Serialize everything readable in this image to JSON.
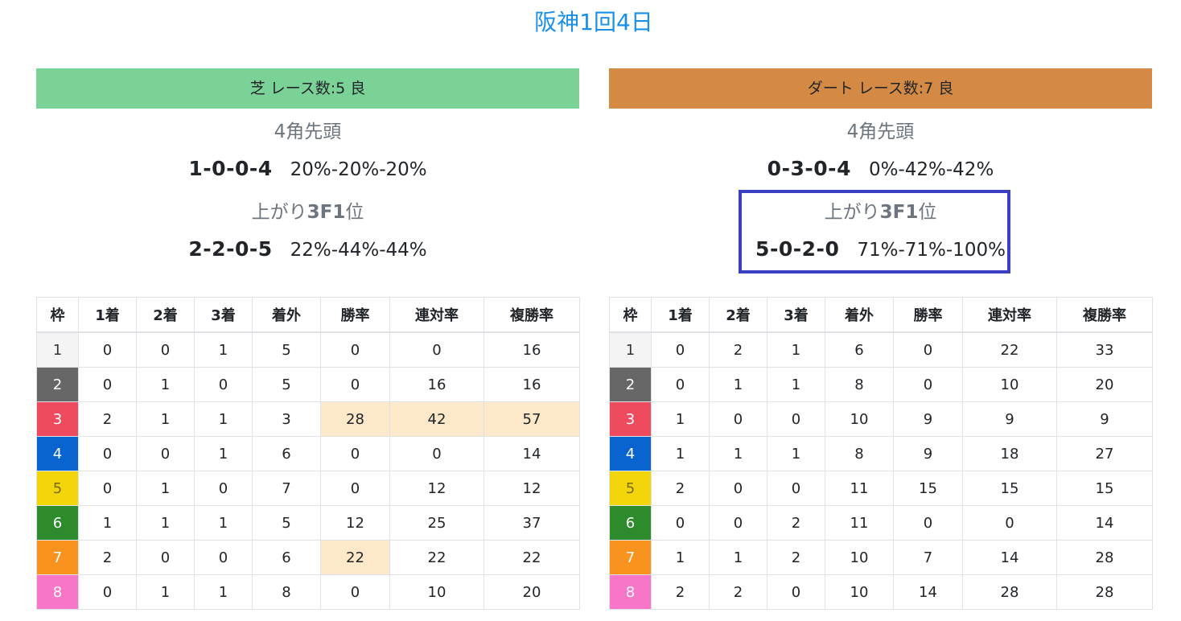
{
  "page_title": "阪神1回4日",
  "headers": [
    "枠",
    "1着",
    "2着",
    "3着",
    "着外",
    "勝率",
    "連対率",
    "複勝率"
  ],
  "panels": [
    {
      "header": "芝 レース数:5 良",
      "header_color": "#7bd297",
      "corner_label": "4角先頭",
      "corner_record": [
        "1",
        "0",
        "0",
        "4"
      ],
      "corner_rates": "20%-20%-20%",
      "agari_label_prefix": "上がり",
      "agari_label_bold": "3F1",
      "agari_label_suffix": "位",
      "agari_record": [
        "2",
        "2",
        "0",
        "5"
      ],
      "agari_rates": "22%-44%-44%",
      "agari_highlighted": false,
      "rows": [
        {
          "frame": "1",
          "c1": "0",
          "c2": "0",
          "c3": "1",
          "out": "5",
          "win": "0",
          "ren": "0",
          "fuku": "16",
          "hl": []
        },
        {
          "frame": "2",
          "c1": "0",
          "c2": "1",
          "c3": "0",
          "out": "5",
          "win": "0",
          "ren": "16",
          "fuku": "16",
          "hl": []
        },
        {
          "frame": "3",
          "c1": "2",
          "c2": "1",
          "c3": "1",
          "out": "3",
          "win": "28",
          "ren": "42",
          "fuku": "57",
          "hl": [
            "win",
            "ren",
            "fuku"
          ]
        },
        {
          "frame": "4",
          "c1": "0",
          "c2": "0",
          "c3": "1",
          "out": "6",
          "win": "0",
          "ren": "0",
          "fuku": "14",
          "hl": []
        },
        {
          "frame": "5",
          "c1": "0",
          "c2": "1",
          "c3": "0",
          "out": "7",
          "win": "0",
          "ren": "12",
          "fuku": "12",
          "hl": []
        },
        {
          "frame": "6",
          "c1": "1",
          "c2": "1",
          "c3": "1",
          "out": "5",
          "win": "12",
          "ren": "25",
          "fuku": "37",
          "hl": []
        },
        {
          "frame": "7",
          "c1": "2",
          "c2": "0",
          "c3": "0",
          "out": "6",
          "win": "22",
          "ren": "22",
          "fuku": "22",
          "hl": [
            "win"
          ]
        },
        {
          "frame": "8",
          "c1": "0",
          "c2": "1",
          "c3": "1",
          "out": "8",
          "win": "0",
          "ren": "10",
          "fuku": "20",
          "hl": []
        }
      ]
    },
    {
      "header": "ダート レース数:7 良",
      "header_color": "#d48a44",
      "corner_label": "4角先頭",
      "corner_record": [
        "0",
        "3",
        "0",
        "4"
      ],
      "corner_rates": "0%-42%-42%",
      "agari_label_prefix": "上がり",
      "agari_label_bold": "3F1",
      "agari_label_suffix": "位",
      "agari_record": [
        "5",
        "0",
        "2",
        "0"
      ],
      "agari_rates": "71%-71%-100%",
      "agari_highlighted": true,
      "rows": [
        {
          "frame": "1",
          "c1": "0",
          "c2": "2",
          "c3": "1",
          "out": "6",
          "win": "0",
          "ren": "22",
          "fuku": "33",
          "hl": []
        },
        {
          "frame": "2",
          "c1": "0",
          "c2": "1",
          "c3": "1",
          "out": "8",
          "win": "0",
          "ren": "10",
          "fuku": "20",
          "hl": []
        },
        {
          "frame": "3",
          "c1": "1",
          "c2": "0",
          "c3": "0",
          "out": "10",
          "win": "9",
          "ren": "9",
          "fuku": "9",
          "hl": []
        },
        {
          "frame": "4",
          "c1": "1",
          "c2": "1",
          "c3": "1",
          "out": "8",
          "win": "9",
          "ren": "18",
          "fuku": "27",
          "hl": []
        },
        {
          "frame": "5",
          "c1": "2",
          "c2": "0",
          "c3": "0",
          "out": "11",
          "win": "15",
          "ren": "15",
          "fuku": "15",
          "hl": []
        },
        {
          "frame": "6",
          "c1": "0",
          "c2": "0",
          "c3": "2",
          "out": "11",
          "win": "0",
          "ren": "0",
          "fuku": "14",
          "hl": []
        },
        {
          "frame": "7",
          "c1": "1",
          "c2": "1",
          "c3": "2",
          "out": "10",
          "win": "7",
          "ren": "14",
          "fuku": "28",
          "hl": []
        },
        {
          "frame": "8",
          "c1": "2",
          "c2": "2",
          "c3": "0",
          "out": "10",
          "win": "14",
          "ren": "28",
          "fuku": "28",
          "hl": []
        }
      ]
    }
  ]
}
